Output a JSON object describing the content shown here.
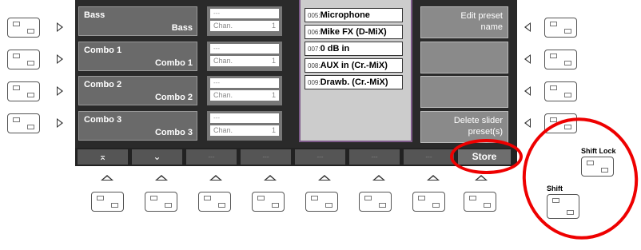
{
  "presets": [
    {
      "name": "Bass",
      "sub": "Bass"
    },
    {
      "name": "Combo 1",
      "sub": "Combo 1"
    },
    {
      "name": "Combo 2",
      "sub": "Combo 2"
    },
    {
      "name": "Combo 3",
      "sub": "Combo 3"
    }
  ],
  "channels": [
    {
      "placeholder": "---",
      "label": "Chan.",
      "value": "1"
    },
    {
      "placeholder": "---",
      "label": "Chan.",
      "value": "1"
    },
    {
      "placeholder": "---",
      "label": "Chan.",
      "value": "1"
    },
    {
      "placeholder": "---",
      "label": "Chan.",
      "value": "1"
    }
  ],
  "sources": [
    {
      "idx": "005:",
      "name": "Microphone"
    },
    {
      "idx": "006:",
      "name": "Mike FX (D-MiX)"
    },
    {
      "idx": "007:",
      "name": "0 dB in"
    },
    {
      "idx": "008:",
      "name": "AUX in (Cr.-MiX)"
    },
    {
      "idx": "009:",
      "name": "Drawb. (Cr.-MiX)"
    }
  ],
  "right_menu": [
    {
      "line1": "Edit preset",
      "line2": "name"
    },
    {
      "line1": "",
      "line2": ""
    },
    {
      "line1": "",
      "line2": ""
    },
    {
      "line1": "Delete slider",
      "line2": "preset(s)"
    }
  ],
  "softkeys": [
    "⌅",
    "⌄",
    "---",
    "---",
    "---",
    "---",
    "---",
    "Store"
  ],
  "shift_lock_label": "Shift Lock",
  "shift_label": "Shift",
  "colors": {
    "highlight_ring": "#e00000",
    "list_border": "#7e5b8a"
  }
}
